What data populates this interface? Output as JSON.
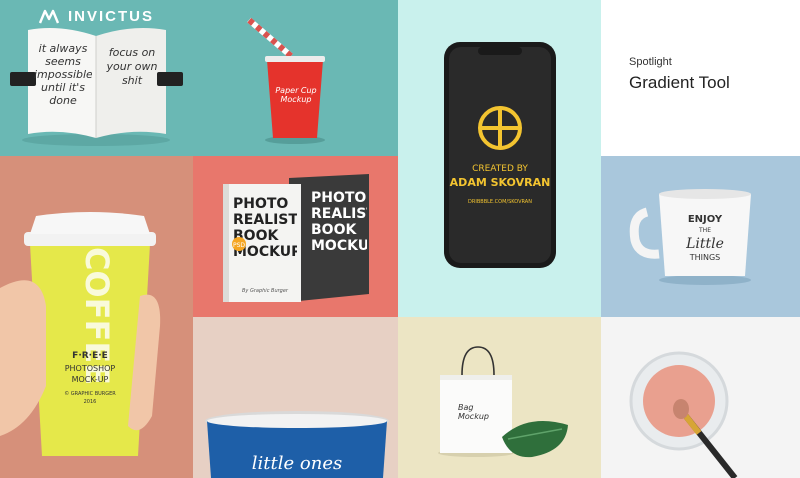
{
  "brand": {
    "name": "INVICTUS"
  },
  "spotlight": {
    "kicker": "Spotlight",
    "title": "Gradient Tool"
  },
  "colors": {
    "teal": "#6ab8b4",
    "mint": "#c9f1ed",
    "salmon": "#d6907a",
    "coral": "#e8776c",
    "sky": "#a9c7dc",
    "beige": "#e7d0c4",
    "cream": "#ece5c4",
    "light": "#f4f4f4",
    "accent_yellow": "#f3c430"
  },
  "tiles": {
    "notebook": {
      "left_page": "it always seems impossible until it's done",
      "right_page": "focus on your own shit"
    },
    "cup": {
      "label": "Paper Cup Mockup"
    },
    "phone": {
      "line1": "CREATED BY",
      "line2": "ADAM SKOVRAN",
      "url": "DRIBBBLE.COM/SKOVRAN"
    },
    "book": {
      "cover": "PHOTO REALISTIC BOOK MOCKUP",
      "badge": "PSD",
      "byline": "By Graphic Burger",
      "spine": "PHOTO REALISTIC BOOK MOCKUP"
    },
    "coffee": {
      "free": "F·R·E·E",
      "line2": "PHOTOSHOP",
      "line3": "MOCK-UP",
      "line4": "© GRAPHIC BURGER",
      "year": "2016",
      "vertical": "COFFEE"
    },
    "mug": {
      "line1": "ENJOY",
      "line2": "THE",
      "line3": "Little",
      "line4": "THINGS"
    },
    "bag": {
      "title": "Bag Mockup"
    },
    "enamel": {
      "script": "little ones"
    }
  }
}
